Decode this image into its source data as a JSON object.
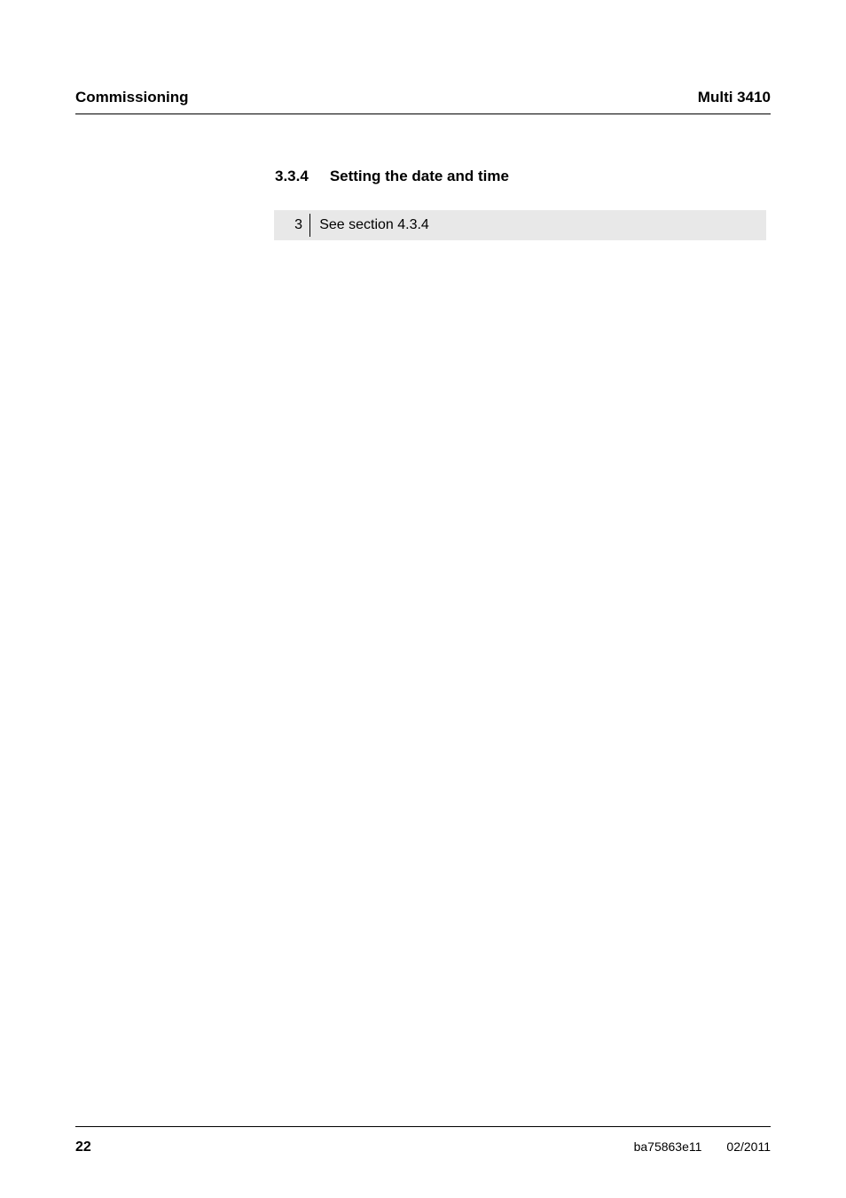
{
  "header": {
    "left": "Commissioning",
    "right": "Multi 3410"
  },
  "section": {
    "number": "3.3.4",
    "title": "Setting the date and time"
  },
  "step": {
    "number": "3",
    "text": "See section 4.3.4"
  },
  "footer": {
    "page": "22",
    "doc_id": "ba75863e11",
    "date": "02/2011"
  }
}
